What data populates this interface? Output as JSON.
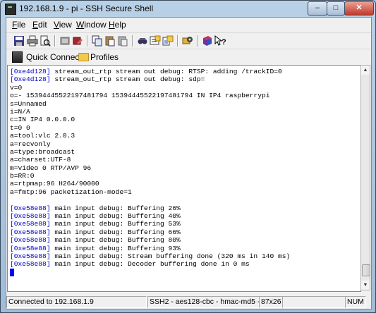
{
  "window": {
    "title": "192.168.1.9 - pi - SSH Secure Shell",
    "min_glyph": "–",
    "max_glyph": "□",
    "close_glyph": "✕"
  },
  "menu": {
    "items": [
      {
        "accel": "F",
        "rest": "ile"
      },
      {
        "accel": "E",
        "rest": "dit"
      },
      {
        "accel": "V",
        "rest": "iew"
      },
      {
        "accel": "W",
        "rest": "indow"
      },
      {
        "accel": "H",
        "rest": "elp"
      }
    ]
  },
  "toolbar": {
    "buttons": [
      "save-icon",
      "print-icon",
      "print-preview-icon",
      "disconnect-icon",
      "connect-settings-icon",
      "copy-icon",
      "paste-icon",
      "paste-special-icon",
      "find-icon",
      "new-terminal-icon",
      "new-file-transfer-icon",
      "settings-icon",
      "help-book-icon",
      "context-help-icon"
    ],
    "quick_connect": "Quick Connect",
    "profiles": "Profiles"
  },
  "terminal": {
    "lines": [
      {
        "addr": "[0xe4d128]",
        "text": " stream_out_rtp stream out debug: RTSP: adding /trackID=0"
      },
      {
        "addr": "[0xe4d128]",
        "text": " stream_out_rtp stream out debug: sdp="
      },
      {
        "addr": "",
        "text": "v=0"
      },
      {
        "addr": "",
        "text": "o=- 15394445522197481794 15394445522197481794 IN IP4 raspberrypi"
      },
      {
        "addr": "",
        "text": "s=Unnamed"
      },
      {
        "addr": "",
        "text": "i=N/A"
      },
      {
        "addr": "",
        "text": "c=IN IP4 0.0.0.0"
      },
      {
        "addr": "",
        "text": "t=0 0"
      },
      {
        "addr": "",
        "text": "a=tool:vlc 2.0.3"
      },
      {
        "addr": "",
        "text": "a=recvonly"
      },
      {
        "addr": "",
        "text": "a=type:broadcast"
      },
      {
        "addr": "",
        "text": "a=charset:UTF-8"
      },
      {
        "addr": "",
        "text": "m=video 0 RTP/AVP 96"
      },
      {
        "addr": "",
        "text": "b=RR:0"
      },
      {
        "addr": "",
        "text": "a=rtpmap:96 H264/90000"
      },
      {
        "addr": "",
        "text": "a=fmtp:96 packetization-mode=1"
      },
      {
        "addr": "",
        "text": ""
      },
      {
        "addr": "[0xe58e88]",
        "text": " main input debug: Buffering 26%"
      },
      {
        "addr": "[0xe58e88]",
        "text": " main input debug: Buffering 40%"
      },
      {
        "addr": "[0xe58e88]",
        "text": " main input debug: Buffering 53%"
      },
      {
        "addr": "[0xe58e88]",
        "text": " main input debug: Buffering 66%"
      },
      {
        "addr": "[0xe58e88]",
        "text": " main input debug: Buffering 80%"
      },
      {
        "addr": "[0xe58e88]",
        "text": " main input debug: Buffering 93%"
      },
      {
        "addr": "[0xe58e88]",
        "text": " main input debug: Stream buffering done (320 ms in 140 ms)"
      },
      {
        "addr": "[0xe58e88]",
        "text": " main input debug: Decoder buffering done in 0 ms"
      }
    ],
    "address_color": "#0000c8",
    "cursor_color": "#0000ff"
  },
  "scrollbar": {
    "position": 0.97,
    "visible_fraction": 0.05
  },
  "status": {
    "connection": "Connected to 192.168.1.9",
    "cipher": "SSH2 - aes128-cbc - hmac-md5 - nc",
    "size": "87x26",
    "num": "NUM"
  }
}
